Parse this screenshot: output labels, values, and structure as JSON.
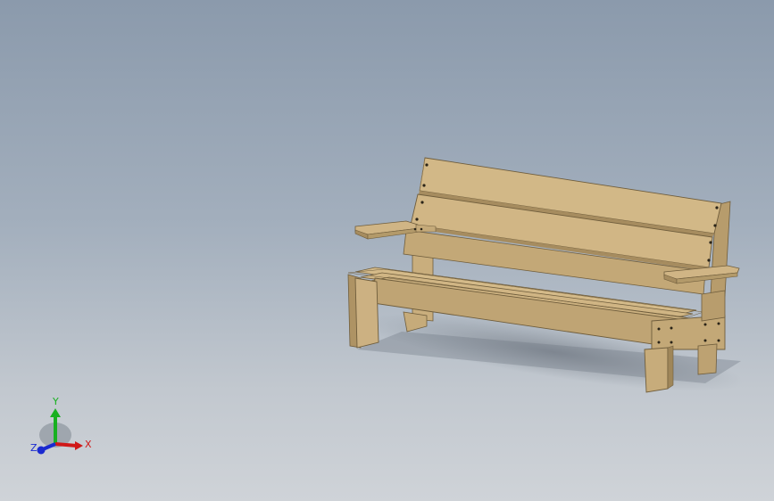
{
  "scene": {
    "model_name": "bench",
    "wood_color": "#cdb384",
    "wood_dark": "#a58c5f",
    "wood_shadow": "#8f7850",
    "screw_color": "#2a2418"
  },
  "triad": {
    "x_label": "X",
    "y_label": "Y",
    "z_label": "Z",
    "x_color": "#d01818",
    "y_color": "#18b020",
    "z_color": "#1a2ad0"
  }
}
